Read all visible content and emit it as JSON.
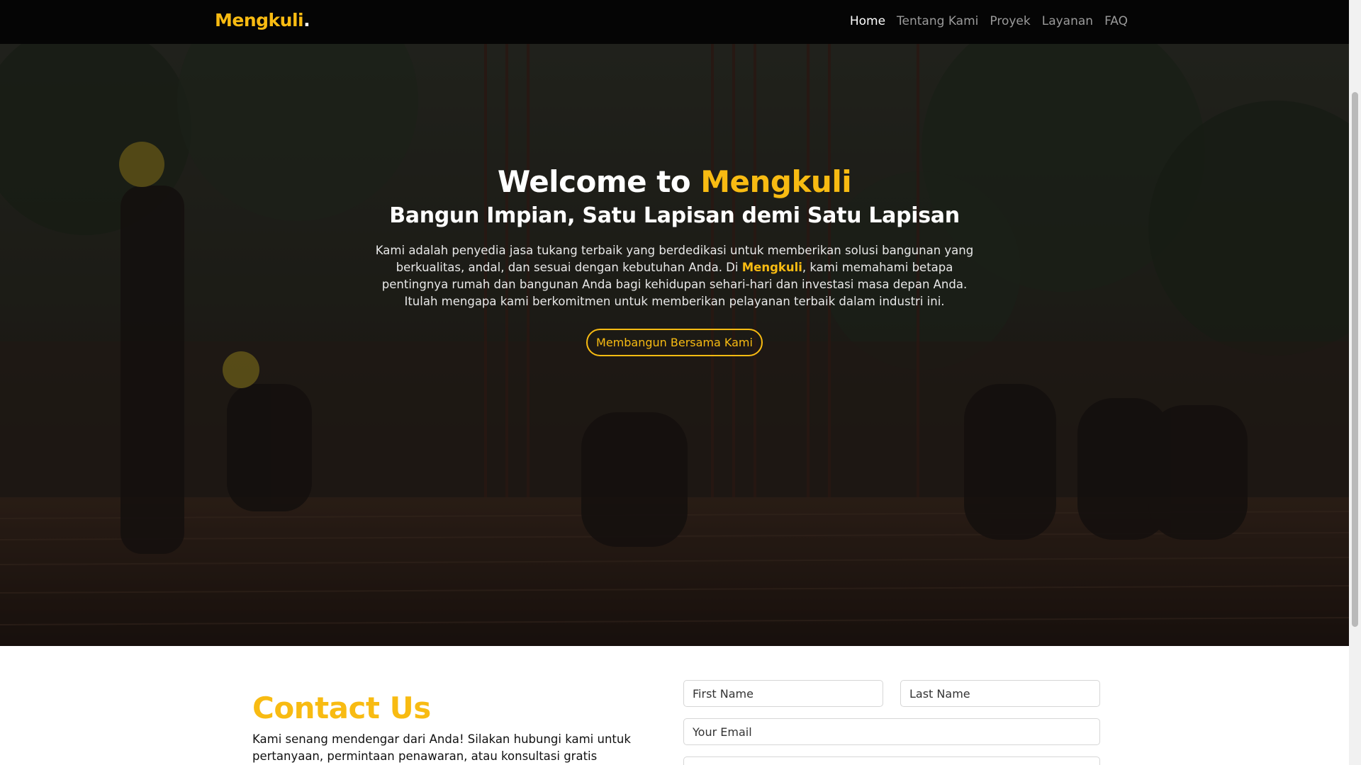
{
  "nav": {
    "brand": "Mengkuli",
    "brand_dot": ".",
    "links": [
      "Home",
      "Tentang Kami",
      "Proyek",
      "Layanan",
      "FAQ"
    ]
  },
  "hero": {
    "title_prefix": "Welcome to ",
    "title_accent": "Mengkuli",
    "subtitle": "Bangun Impian, Satu Lapisan demi Satu Lapisan",
    "desc_before": "Kami adalah penyedia jasa tukang terbaik yang berdedikasi untuk memberikan solusi bangunan yang berkualitas, andal, dan sesuai dengan kebutuhan Anda. Di ",
    "desc_accent": "Mengkuli",
    "desc_after": ", kami memahami betapa pentingnya rumah dan bangunan Anda bagi kehidupan sehari-hari dan investasi masa depan Anda. Itulah mengapa kami berkomitmen untuk memberikan pelayanan terbaik dalam industri ini.",
    "cta": "Membangun Bersama Kami"
  },
  "contact": {
    "title": "Contact Us",
    "text": "Kami senang mendengar dari Anda! Silakan hubungi kami untuk pertanyaan, permintaan penawaran, atau konsultasi gratis mengenai",
    "first_name_placeholder": "First Name",
    "last_name_placeholder": "Last Name",
    "email_placeholder": "Your Email"
  },
  "colors": {
    "accent": "#f8bb12",
    "navbar": "#050505"
  }
}
